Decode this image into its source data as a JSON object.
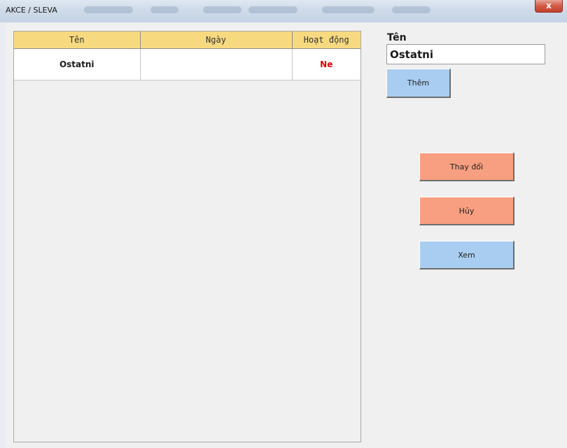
{
  "window": {
    "title": "AKCE / SLEVA",
    "close_glyph": "x"
  },
  "table": {
    "columns": [
      "Tên",
      "Ngày",
      "Hoạt động"
    ],
    "rows": [
      {
        "name": "Ostatni",
        "date": "",
        "active": "Ne"
      }
    ]
  },
  "form": {
    "name_label": "Tên",
    "name_value": "Ostatni",
    "add_label": "Thêm"
  },
  "actions": {
    "change_label": "Thay đổi",
    "cancel_label": "Hủy",
    "view_label": "Xem"
  },
  "colors": {
    "header_bg": "#f7d97f",
    "blue_button": "#a9cdf0",
    "orange_button": "#f79f80",
    "inactive_text": "#e60000"
  },
  "icons": [
    "close-icon"
  ]
}
